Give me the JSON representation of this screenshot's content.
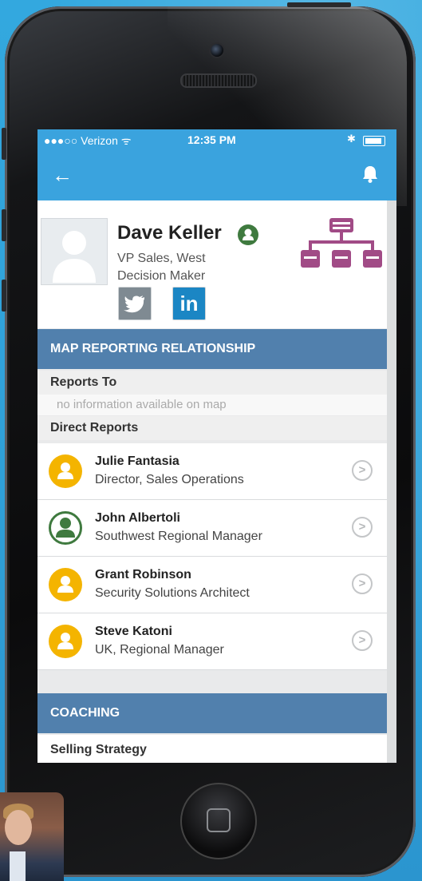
{
  "status_bar": {
    "carrier": "●●●○○ Verizon ᯤ",
    "time": "12:35 PM"
  },
  "nav": {
    "back_icon": "back-arrow-icon",
    "bell_icon": "bell-icon"
  },
  "profile": {
    "name": "Dave Keller",
    "title": "VP Sales, West",
    "role": "Decision Maker",
    "social": [
      "twitter",
      "linkedin"
    ],
    "linkedin_label": "in"
  },
  "map_section": {
    "header": "MAP REPORTING RELATIONSHIP",
    "reports_to_label": "Reports To",
    "reports_to_empty": "no information available on map",
    "direct_reports_label": "Direct Reports",
    "direct_reports": [
      {
        "name": "Julie Fantasia",
        "title": "Director, Sales Operations",
        "avatar_color": "#f4b400"
      },
      {
        "name": "John Albertoli",
        "title": "Southwest Regional Manager",
        "avatar_color": "#3f7a3f"
      },
      {
        "name": "Grant Robinson",
        "title": "Security Solutions Architect",
        "avatar_color": "#f4b400"
      },
      {
        "name": "Steve Katoni",
        "title": "UK, Regional Manager",
        "avatar_color": "#f4b400"
      }
    ]
  },
  "coaching_section": {
    "header": "COACHING",
    "first_item": "Selling Strategy"
  },
  "colors": {
    "accent_blue": "#3aa3de",
    "section_header": "#5180ad",
    "org_icon": "#a14b86"
  }
}
